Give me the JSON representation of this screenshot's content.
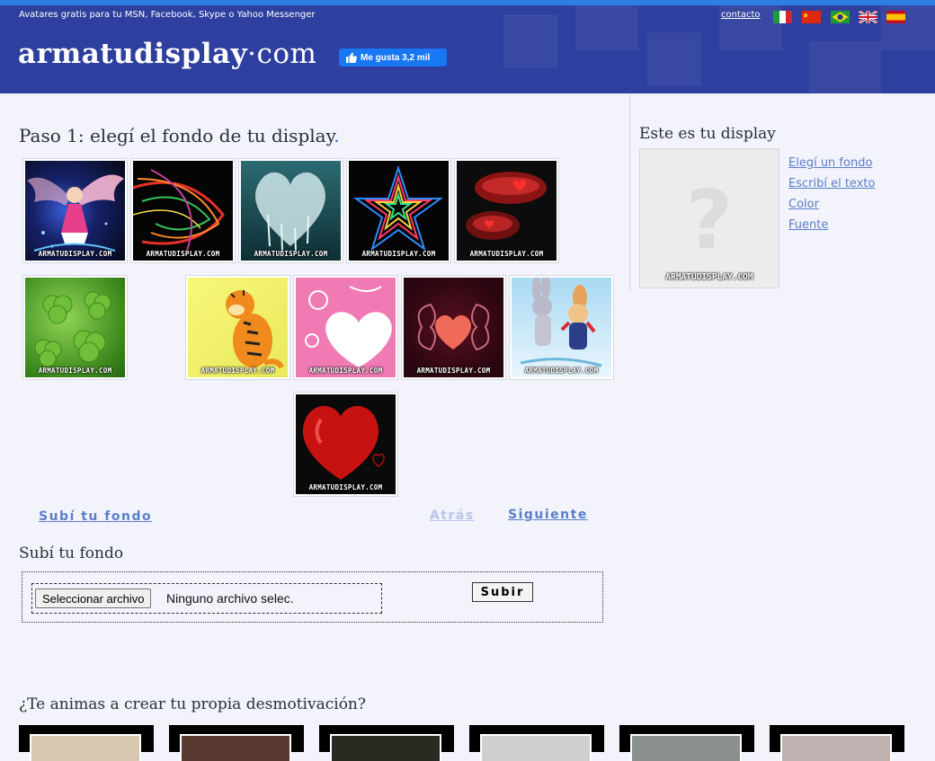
{
  "header": {
    "tagline": "Avatares gratis para tu MSN, Facebook, Skype o Yahoo Messenger",
    "brand_bold": "armatudisplay",
    "brand_rest": "·com",
    "fb_like": "Me gusta 3,2 mil",
    "contact": "contacto",
    "flags": [
      "flag-italy",
      "flag-china",
      "flag-brazil",
      "flag-uk",
      "flag-spain"
    ]
  },
  "step": {
    "title": "Paso 1: elegí el fondo de tu display",
    "title_dot": ".",
    "watermark": "ARMATUDISPLAY.COM",
    "thumbnails": [
      "anime-angel",
      "neon-swirl",
      "ice-heart",
      "neon-star",
      "red-lips-heart",
      "clover",
      "tigger",
      "pink-heart",
      "ornate-heart",
      "bugs-lola",
      "red-heart"
    ]
  },
  "nav": {
    "upload": "Subí tu fondo",
    "back": "Atrás",
    "next": "Siguiente"
  },
  "upload": {
    "title": "Subí tu fondo",
    "file_button": "Seleccionar archivo",
    "file_status": "Ninguno archivo selec.",
    "submit": "Subir"
  },
  "sidebar": {
    "title": "Este es tu display",
    "watermark": "ARMATUDISPLAY.COM",
    "links": [
      "Elegí un fondo",
      "Escribí el texto",
      "Color",
      "Fuente"
    ]
  },
  "desmo": {
    "title": "¿Te animas a crear tu propia desmotivación?"
  },
  "colors": {
    "header_bg": "#2e3f9f",
    "top_line": "#2f7ee6",
    "page_bg": "#f2f3fb",
    "link": "#5a7fc8"
  }
}
